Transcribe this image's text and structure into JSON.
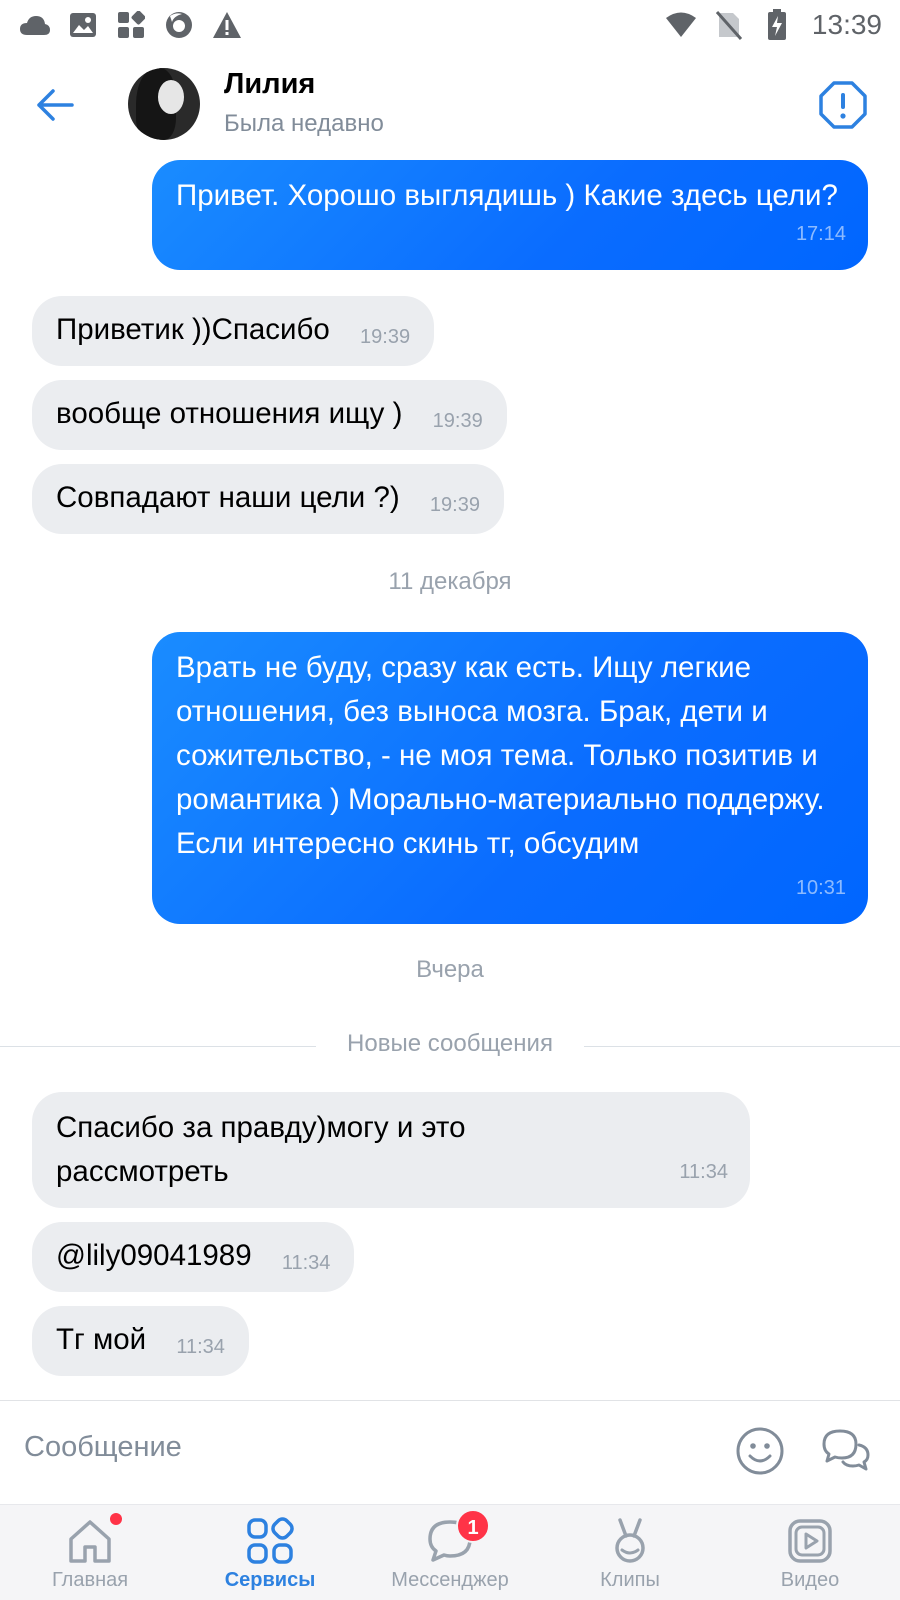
{
  "status_bar": {
    "time": "13:39",
    "left_icons": [
      "cloud-icon",
      "image-icon",
      "apps-icon",
      "firefox-icon",
      "warning-icon"
    ],
    "right_icons": [
      "wifi-icon",
      "no-sim-icon",
      "battery-charging-icon"
    ]
  },
  "header": {
    "contact_name": "Лилия",
    "contact_status": "Была недавно"
  },
  "messages": [
    {
      "dir": "out",
      "text": "Привет. Хорошо выглядишь ) Какие здесь цели?",
      "time": "17:14"
    },
    {
      "dir": "in",
      "text": "Приветик ))Спасибо",
      "time": "19:39"
    },
    {
      "dir": "in",
      "text": "вообще отношения ищу )",
      "time": "19:39"
    },
    {
      "dir": "in",
      "text": "Совпадают наши цели ?)",
      "time": "19:39"
    },
    {
      "dir": "out",
      "text": "Врать не буду, сразу как есть. Ищу легкие отношения, без выноса мозга. Брак, дети и сожительство, - не моя тема. Только позитив и романтика ) Морально-материально поддержу. Если интересно скинь тг, обсудим",
      "time": "10:31"
    },
    {
      "dir": "in",
      "text": "Спасибо за правду)могу и это рассмотреть",
      "time": "11:34"
    },
    {
      "dir": "in",
      "text": "@lily09041989",
      "time": "11:34"
    },
    {
      "dir": "in",
      "text": "Тг мой",
      "time": "11:34"
    }
  ],
  "separators": {
    "date1": "11 декабря",
    "date2": "Вчера",
    "new_messages": "Новые сообщения"
  },
  "input": {
    "placeholder": "Сообщение"
  },
  "nav": {
    "items": [
      {
        "label": "Главная",
        "icon": "home-icon"
      },
      {
        "label": "Сервисы",
        "icon": "services-icon"
      },
      {
        "label": "Мессенджер",
        "icon": "messenger-icon",
        "badge": "1"
      },
      {
        "label": "Клипы",
        "icon": "clips-icon"
      },
      {
        "label": "Видео",
        "icon": "video-icon"
      }
    ],
    "active": "Сервисы"
  },
  "colors": {
    "accent": "#2d81e0",
    "outgoing_bubble": "#0a6cff",
    "incoming_bubble": "#ebedf0",
    "badge": "#ff3347"
  }
}
